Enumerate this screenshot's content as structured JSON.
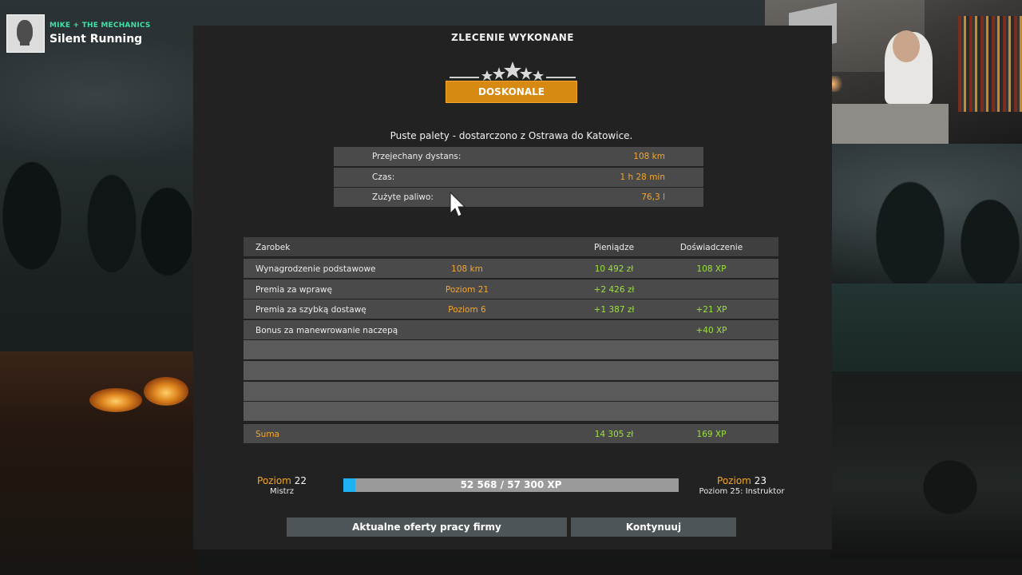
{
  "now_playing": {
    "artist": "MIKE + THE MECHANICS",
    "title": "Silent Running"
  },
  "panel": {
    "title": "ZLECENIE WYKONANE",
    "rating_stars": 5,
    "rating_label": "DOSKONALE",
    "cargo_text": "Puste palety - dostarczono z Ostrawa do Katowice."
  },
  "stats": [
    {
      "label": "Przejechany dystans:",
      "value": "108 km"
    },
    {
      "label": "Czas:",
      "value": "1 h 28 min"
    },
    {
      "label": "Zużyte paliwo:",
      "value": "76,3 l"
    }
  ],
  "earnings": {
    "headers": {
      "label": "Zarobek",
      "money": "Pieniądze",
      "xp": "Doświadczenie"
    },
    "rows": [
      {
        "label": "Wynagrodzenie podstawowe",
        "qty": "108 km",
        "money": "10 492 zł",
        "xp": "108 XP"
      },
      {
        "label": "Premia za wprawę",
        "qty": "Poziom 21",
        "money": "+2 426 zł",
        "xp": ""
      },
      {
        "label": "Premia za szybką dostawę",
        "qty": "Poziom 6",
        "money": "+1 387 zł",
        "xp": "+21 XP"
      },
      {
        "label": "Bonus za manewrowanie naczepą",
        "qty": "",
        "money": "",
        "xp": "+40 XP"
      }
    ],
    "sum": {
      "label": "Suma",
      "money": "14 305 zł",
      "xp": "169 XP"
    }
  },
  "level": {
    "current_word": "Poziom",
    "current_num": "22",
    "current_title": "Mistrz",
    "next_word": "Poziom",
    "next_num": "23",
    "next_note": "Poziom 25: Instruktor",
    "xp_text": "52 568 / 57 300 XP",
    "xp_fraction": 0.035
  },
  "buttons": {
    "offers": "Aktualne oferty pracy firmy",
    "continue": "Kontynuuj"
  },
  "colors": {
    "accent_orange": "#f4a62a",
    "banner_gold": "#d68a12",
    "value_green": "#9be23c",
    "xp_blue": "#1fb0f0",
    "now_playing_green": "#3fe0a5"
  }
}
